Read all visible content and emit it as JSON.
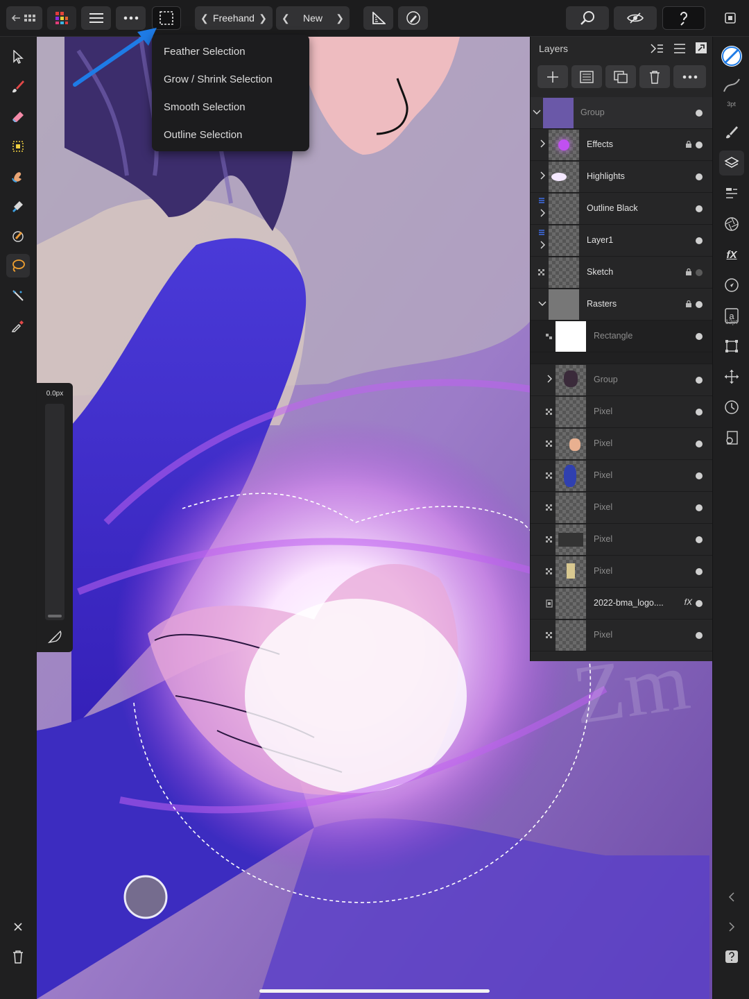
{
  "toolbar": {
    "selection_mode_label": "Freehand",
    "selection_type_label": "New"
  },
  "selection_menu": {
    "items": [
      {
        "label": "Feather Selection"
      },
      {
        "label": "Grow / Shrink Selection"
      },
      {
        "label": "Smooth Selection"
      },
      {
        "label": "Outline Selection"
      }
    ]
  },
  "brush": {
    "size_label": "0.0px",
    "size_value": 0
  },
  "layers_panel": {
    "title": "Layers",
    "rows": [
      {
        "name": "Group",
        "dim": true,
        "expanded": true,
        "visible": true
      },
      {
        "name": "Effects",
        "dim": false,
        "locked": true,
        "visible": true
      },
      {
        "name": "Highlights",
        "dim": false,
        "visible": true
      },
      {
        "name": "Outline Black",
        "dim": false,
        "visible": true
      },
      {
        "name": "Layer1",
        "dim": false,
        "visible": true
      },
      {
        "name": "Sketch",
        "dim": false,
        "locked": true,
        "visible": false
      },
      {
        "name": "Rasters",
        "dim": false,
        "locked": true,
        "expanded": true,
        "visible": true
      },
      {
        "name": "Rectangle",
        "dim": true,
        "visible": true
      },
      {
        "name": "Group",
        "dim": true,
        "visible": true
      },
      {
        "name": "Pixel",
        "dim": true,
        "visible": true
      },
      {
        "name": "Pixel",
        "dim": true,
        "visible": true
      },
      {
        "name": "Pixel",
        "dim": true,
        "visible": true
      },
      {
        "name": "Pixel",
        "dim": true,
        "visible": true
      },
      {
        "name": "Pixel",
        "dim": true,
        "visible": true
      },
      {
        "name": "Pixel",
        "dim": true,
        "visible": true
      },
      {
        "name": "2022-bma_logo....",
        "dim": false,
        "fx": true,
        "visible": true
      },
      {
        "name": "Pixel",
        "dim": true,
        "visible": true
      }
    ]
  },
  "studio": {
    "stroke_width_label": "3pt",
    "font_size_label": "12pt"
  },
  "icons": {
    "accent_blue": "#1e7be6",
    "lasso_active": "#f0a030",
    "home_bar": "#f3f3f3"
  }
}
